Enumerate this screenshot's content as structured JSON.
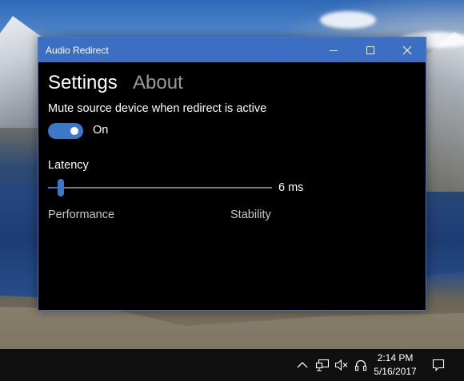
{
  "window": {
    "title": "Audio Redirect"
  },
  "tabs": [
    {
      "label": "Settings",
      "selected": true
    },
    {
      "label": "About",
      "selected": false
    }
  ],
  "settings": {
    "mute_label": "Mute source device when redirect is active",
    "mute_toggle_on": true,
    "mute_toggle_state": "On",
    "latency_label": "Latency",
    "latency_value_text": "6 ms",
    "latency_slider_fraction": 0.05,
    "performance_label": "Performance",
    "stability_label": "Stability"
  },
  "taskbar": {
    "time": "2:14 PM",
    "date": "5/16/2017",
    "tray_icons": [
      "chevron-up-icon",
      "network-icon",
      "volume-muted-icon",
      "headphones-icon",
      "action-center-icon"
    ]
  },
  "colors": {
    "accent": "#3c78c8",
    "titlebar": "#3c6fc4",
    "window_bg": "#000000",
    "taskbar": "#101010"
  }
}
